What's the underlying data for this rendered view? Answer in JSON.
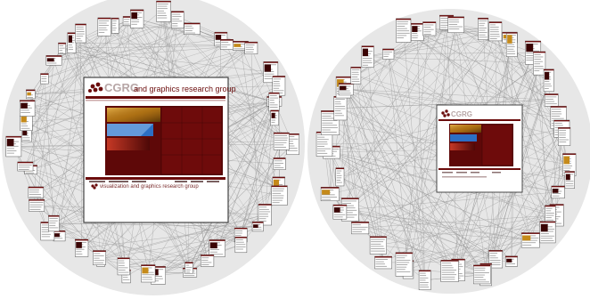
{
  "figure": {
    "panels": [
      {
        "id": "left",
        "focus_page": {
          "logo_text": "CGRG",
          "header_text": "and graphics research group",
          "footer_text": "visualization and graphics research group"
        }
      },
      {
        "id": "right",
        "focus_page": {
          "logo_text": "CGRG",
          "header_text": "",
          "footer_text": ""
        }
      }
    ],
    "colors": {
      "background": "#ffffff",
      "halo": "#e7e7e7",
      "edge": "#9a9a9a",
      "page_frame": "#444444",
      "brand": "#6b0c0c",
      "brand_dark": "#3a0404",
      "amber": "#c58a1a",
      "blue": "#2c6fc4"
    }
  }
}
